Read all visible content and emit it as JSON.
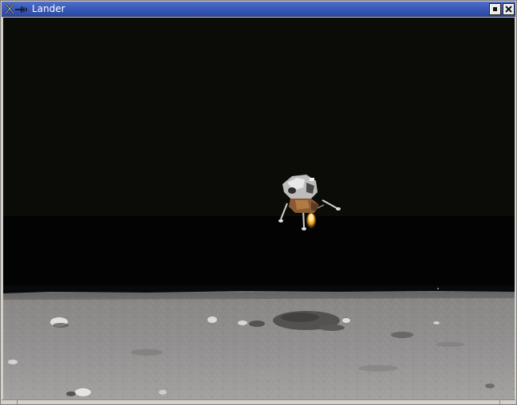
{
  "window": {
    "title": "Lander",
    "app_icon": "x-window-icon",
    "buttons": {
      "maximize_icon": "maximize-icon",
      "close_icon": "close-icon"
    }
  },
  "scene": {
    "sky_color": "#0b0b07",
    "horizon_band_color": "#030303",
    "ground_color": "#8b8987",
    "lander_flame_color": "#f0a623"
  }
}
